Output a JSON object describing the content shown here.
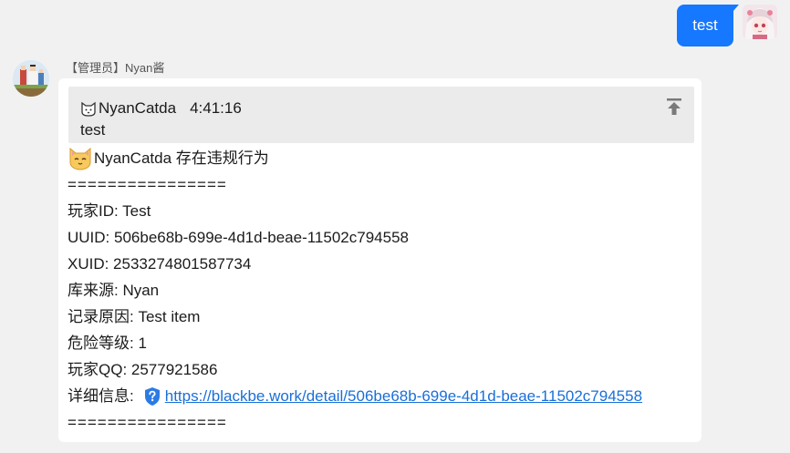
{
  "outgoing": {
    "text": "test"
  },
  "incoming": {
    "sender": "【管理员】Nyan酱",
    "quote": {
      "author": "NyanCatda",
      "time": "4:41:16",
      "text": "test"
    },
    "title": "NyanCatda 存在违规行为",
    "separator": "================",
    "fields": [
      "玩家ID: Test",
      "UUID: 506be68b-699e-4d1d-beae-11502c794558",
      "XUID: 2533274801587734",
      "库来源: Nyan",
      "记录原因: Test item",
      "危险等级: 1",
      "玩家QQ: 2577921586"
    ],
    "detail_label": "详细信息:",
    "detail_link": "https://blackbe.work/detail/506be68b-699e-4d1d-beae-11502c794558",
    "separator_end": "================"
  },
  "icons": {
    "cat_emoji": "cat-face-icon",
    "shield": "blue-shield-question-icon",
    "jump": "arrow-up-to-top-icon"
  },
  "colors": {
    "accent": "#1677ff",
    "link": "#1a6fd8",
    "quote_bg": "#ebebeb",
    "page_bg": "#f1f1f2"
  }
}
